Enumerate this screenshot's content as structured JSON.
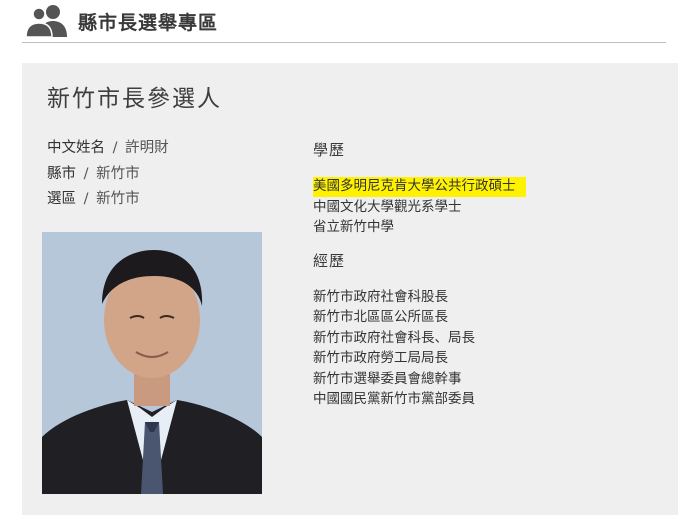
{
  "header": {
    "title": "縣市長選舉專區",
    "icon": "users-icon"
  },
  "panel": {
    "title": "新竹市長參選人",
    "info": [
      {
        "label": "中文姓名",
        "sep": "/",
        "value": "許明財"
      },
      {
        "label": "縣市",
        "sep": "/",
        "value": "新竹市"
      },
      {
        "label": "選區",
        "sep": "/",
        "value": "新竹市"
      }
    ],
    "education": {
      "title": "學歷",
      "items": [
        "美國多明尼克肯大學公共行政碩士",
        "中國文化大學觀光系學士",
        "省立新竹中學"
      ]
    },
    "experience": {
      "title": "經歷",
      "items": [
        "新竹市政府社會科股長",
        "新竹市北區區公所區長",
        "新竹市政府社會科長、局長",
        "新竹市政府勞工局局長",
        "新竹市選舉委員會總幹事",
        "中國國民黨新竹市黨部委員"
      ]
    }
  },
  "colors": {
    "panel_bg": "#efefef",
    "highlight": "#fff200",
    "text": "#333333"
  }
}
